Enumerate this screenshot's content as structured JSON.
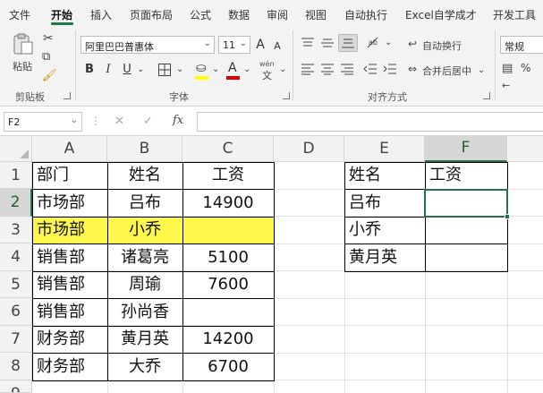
{
  "menu": {
    "tabs": [
      "文件",
      "开始",
      "插入",
      "页面布局",
      "公式",
      "数据",
      "审阅",
      "视图",
      "自动执行",
      "Excel自学成才",
      "开发工具"
    ],
    "active": "开始"
  },
  "ribbon": {
    "clipboard": {
      "paste_label": "粘贴",
      "group_label": "剪贴板"
    },
    "font": {
      "font_name": "阿里巴巴普惠体",
      "font_size": "11",
      "grow_glyph": "A",
      "shrink_glyph": "A",
      "bold": "B",
      "italic": "I",
      "underline": "U",
      "font_color_glyph": "A",
      "phonetic_glyph": "wén",
      "group_label": "字体"
    },
    "alignment": {
      "wrap_text": "自动换行",
      "merge_center": "合并后居中",
      "group_label": "对齐方式"
    },
    "number": {
      "format": "常规"
    }
  },
  "formula_bar": {
    "name_box": "F2",
    "fx": "fx",
    "formula": ""
  },
  "sheet": {
    "columns": [
      "A",
      "B",
      "C",
      "D",
      "E",
      "F"
    ],
    "rows": [
      "1",
      "2",
      "3",
      "4",
      "5",
      "6",
      "7",
      "8",
      "9"
    ],
    "selected_cell": "F2",
    "cells": {
      "A1": "部门",
      "B1": "姓名",
      "C1": "工资",
      "A2": "市场部",
      "B2": "吕布",
      "C2": "14900",
      "A3": "市场部",
      "B3": "小乔",
      "C3": "",
      "A4": "销售部",
      "B4": "诸葛亮",
      "C4": "5100",
      "A5": "销售部",
      "B5": "周瑜",
      "C5": "7600",
      "A6": "销售部",
      "B6": "孙尚香",
      "C6": "",
      "A7": "财务部",
      "B7": "黄月英",
      "C7": "14200",
      "A8": "财务部",
      "B8": "大乔",
      "C8": "6700",
      "E1": "姓名",
      "F1": "工资",
      "E2": "吕布",
      "F2": "",
      "E3": "小乔",
      "F3": "",
      "E4": "黄月英",
      "F4": ""
    },
    "highlight_color": "#fff84c",
    "selection_color": "#217346"
  }
}
